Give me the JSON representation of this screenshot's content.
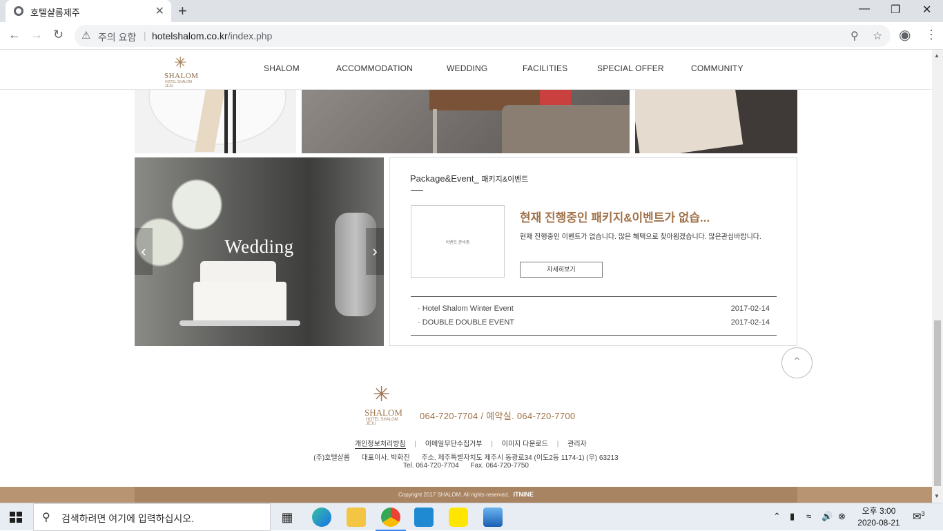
{
  "browser": {
    "tab_title": "호텔샬롬제주",
    "tab_close": "✕",
    "new_tab": "+",
    "security_warning": "주의 요함",
    "url_host": "hotelshalom.co.kr",
    "url_path": "/index.php"
  },
  "site": {
    "logo_text": "SHALOM",
    "logo_sub": "HOTEL SHALOM JEJU",
    "menu": [
      "SHALOM",
      "ACCOMMODATION",
      "WEDDING",
      "FACILITIES",
      "SPECIAL OFFER",
      "COMMUNITY"
    ]
  },
  "wedding_banner": {
    "label": "Wedding",
    "prev": "‹",
    "next": "›"
  },
  "package": {
    "heading": "Package&Event_",
    "heading_kr": "패키지&이벤트",
    "thumb_placeholder": "이벤트 준비중",
    "title": "현재 진행중인 패키지&이벤트가 없습...",
    "description": "현재 진행중인 이벤트가 없습니다. 많은 혜택으로 찾아뵙겠습니다. 많은관심바랍니다.",
    "more_button": "자세히보기",
    "events": [
      {
        "title": "· Hotel Shalom Winter Event",
        "date": "2017-02-14"
      },
      {
        "title": "· DOUBLE DOUBLE EVENT",
        "date": "2017-02-14"
      }
    ]
  },
  "footer": {
    "logo_text": "SHALOM",
    "logo_sub": "HOTEL SHALOM JEJU",
    "phone": "064-720-7704 / 예약실. 064-720-7700",
    "links": [
      "개인정보처리방침",
      "이메일무단수집거부",
      "이미지 다운로드",
      "관리자"
    ],
    "link_separator": "|",
    "company": "(주)호텔샬롬",
    "ceo": "대표이사. 박화진",
    "address": "주소. 제주특별자치도 제주시 동광로34 (이도2동 1174-1) (우) 63213",
    "tel": "Tel. 064-720-7704",
    "fax": "Fax. 064-720-7750",
    "copyright": "Copyright 2017 SHALOM. All rights reserved.",
    "maker": "ITNINE"
  },
  "taskbar": {
    "search_placeholder": "검색하려면 여기에 입력하십시오.",
    "time": "오후 3:00",
    "date": "2020-08-21",
    "notification_count": "3"
  },
  "colors": {
    "accent": "#a07248",
    "footer_bar": "#a88462",
    "taskbar": "#e7edf3"
  }
}
